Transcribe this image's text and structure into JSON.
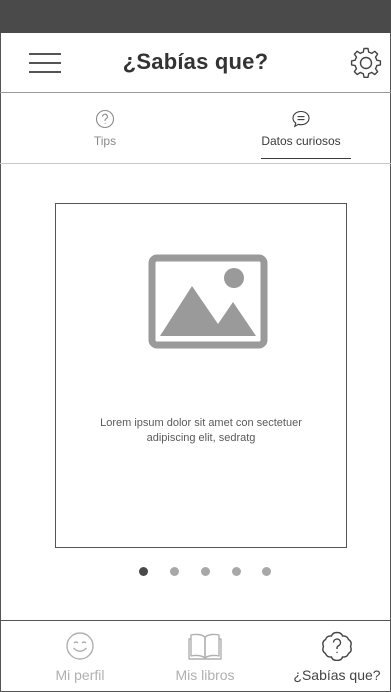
{
  "colors": {
    "status_bar": "#4a4a4a",
    "text": "#3a3a3a",
    "muted": "#b0b0b0",
    "placeholder_image": "#9a9a9a",
    "dot_inactive": "#a8a8a8",
    "dot_active": "#4a4a4a"
  },
  "header": {
    "title": "¿Sabías que?",
    "menu_icon": "hamburger-menu-icon",
    "settings_icon": "gear-icon"
  },
  "tabs": [
    {
      "label": "Tips",
      "icon": "question-circle-icon",
      "active": false
    },
    {
      "label": "Datos curiosos",
      "icon": "speech-bubble-icon",
      "active": true
    }
  ],
  "card": {
    "image_icon": "image-placeholder-icon",
    "text": "Lorem ipsum dolor sit amet con sectetuer adipiscing elit, sedratg"
  },
  "pager": {
    "count": 5,
    "active_index": 0
  },
  "bottom_nav": [
    {
      "label": "Mi perfil",
      "icon": "smiley-icon",
      "active": false
    },
    {
      "label": "Mis libros",
      "icon": "open-book-icon",
      "active": false
    },
    {
      "label": "¿Sabías que?",
      "icon": "question-cloud-icon",
      "active": true
    }
  ]
}
